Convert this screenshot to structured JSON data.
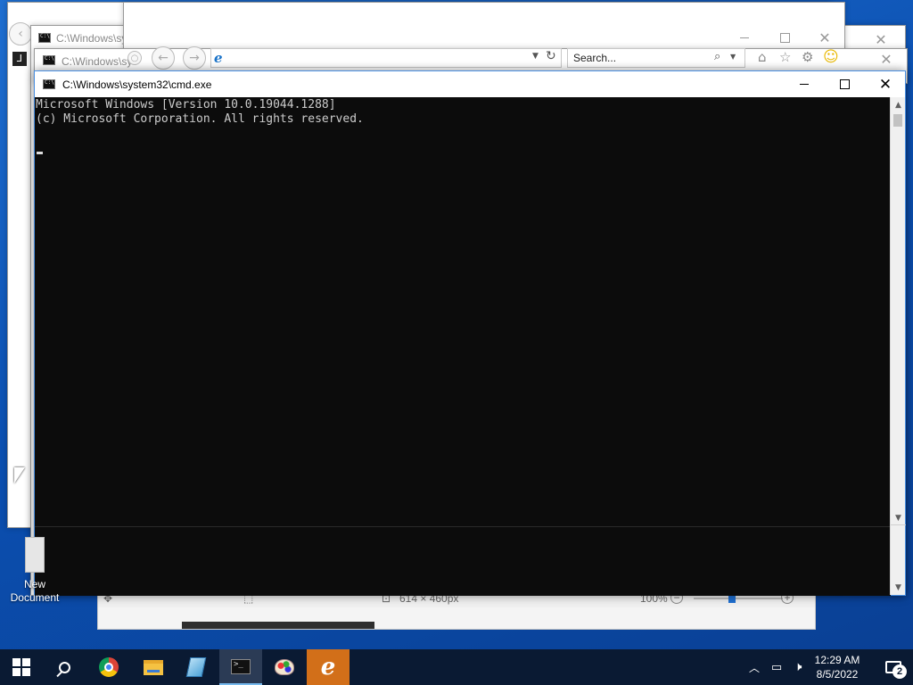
{
  "background_windows": [
    {
      "title": "C:\\Windows\\sy"
    },
    {
      "title": "C:\\Windows\\sy"
    }
  ],
  "ie_window": {
    "search_placeholder": "Search..."
  },
  "cmd_window": {
    "title": "C:\\Windows\\system32\\cmd.exe",
    "lines": [
      "Microsoft Windows [Version 10.0.19044.1288]",
      "(c) Microsoft Corporation. All rights reserved."
    ]
  },
  "paint_status": {
    "dimensions": "614 × 460px",
    "zoom": "100%"
  },
  "desktop_icons": [
    {
      "label_line1": "New",
      "label_line2": "Document"
    }
  ],
  "taskbar": {
    "apps": [
      {
        "name": "Search",
        "icon": "search-icon"
      },
      {
        "name": "Google Chrome",
        "icon": "chrome-icon"
      },
      {
        "name": "File Explorer",
        "icon": "folder-icon"
      },
      {
        "name": "Notepad",
        "icon": "notepad-icon"
      },
      {
        "name": "Command Prompt",
        "icon": "cmd-icon"
      },
      {
        "name": "Paint",
        "icon": "paint-icon"
      },
      {
        "name": "Internet Explorer",
        "icon": "ie-icon"
      }
    ],
    "clock": {
      "time": "12:29 AM",
      "date": "8/5/2022"
    },
    "notification_count": "2",
    "accent_color": "#76b9ed",
    "ie_active_color": "#d26f19"
  }
}
